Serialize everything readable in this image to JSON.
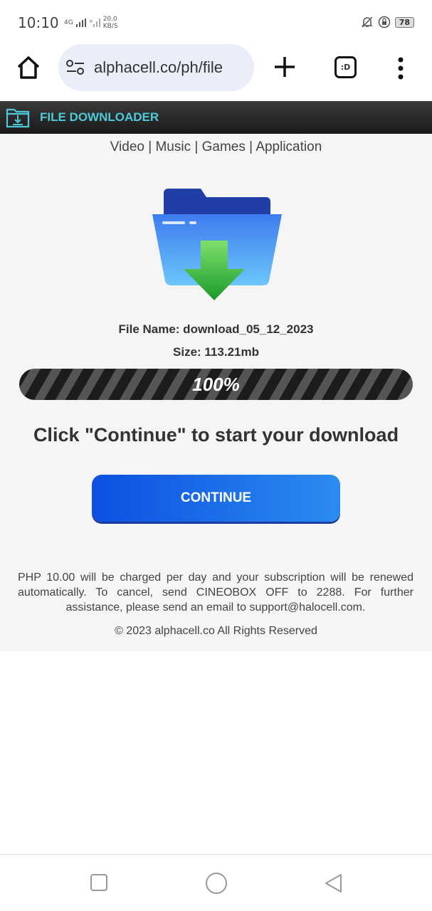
{
  "status": {
    "time": "10:10",
    "network": "4G",
    "speed_value": "20.0",
    "speed_unit": "KB/S",
    "battery": "78"
  },
  "browser": {
    "url": "alphacell.co/ph/file",
    "tabs_label": ":D"
  },
  "header": {
    "title": "FILE DOWNLOADER"
  },
  "categories": [
    "Video",
    "Music",
    "Games",
    "Application"
  ],
  "file": {
    "name": "File Name: download_05_12_2023",
    "size": "Size: 113.21mb"
  },
  "progress": {
    "value": 100,
    "label": "100%"
  },
  "headline": "Click \"Continue\" to start your download",
  "continue_label": "CONTINUE",
  "notice": "PHP 10.00 will be charged per day and your subscription will be renewed automatically. To cancel, send CINEOBOX OFF to 2288. For further assistance, please send an email to support@halocell.com.",
  "copyright": "© 2023 alphacell.co   All Rights Reserved",
  "colors": {
    "accent": "#4ec9d8",
    "button": "#1a6ce8"
  }
}
